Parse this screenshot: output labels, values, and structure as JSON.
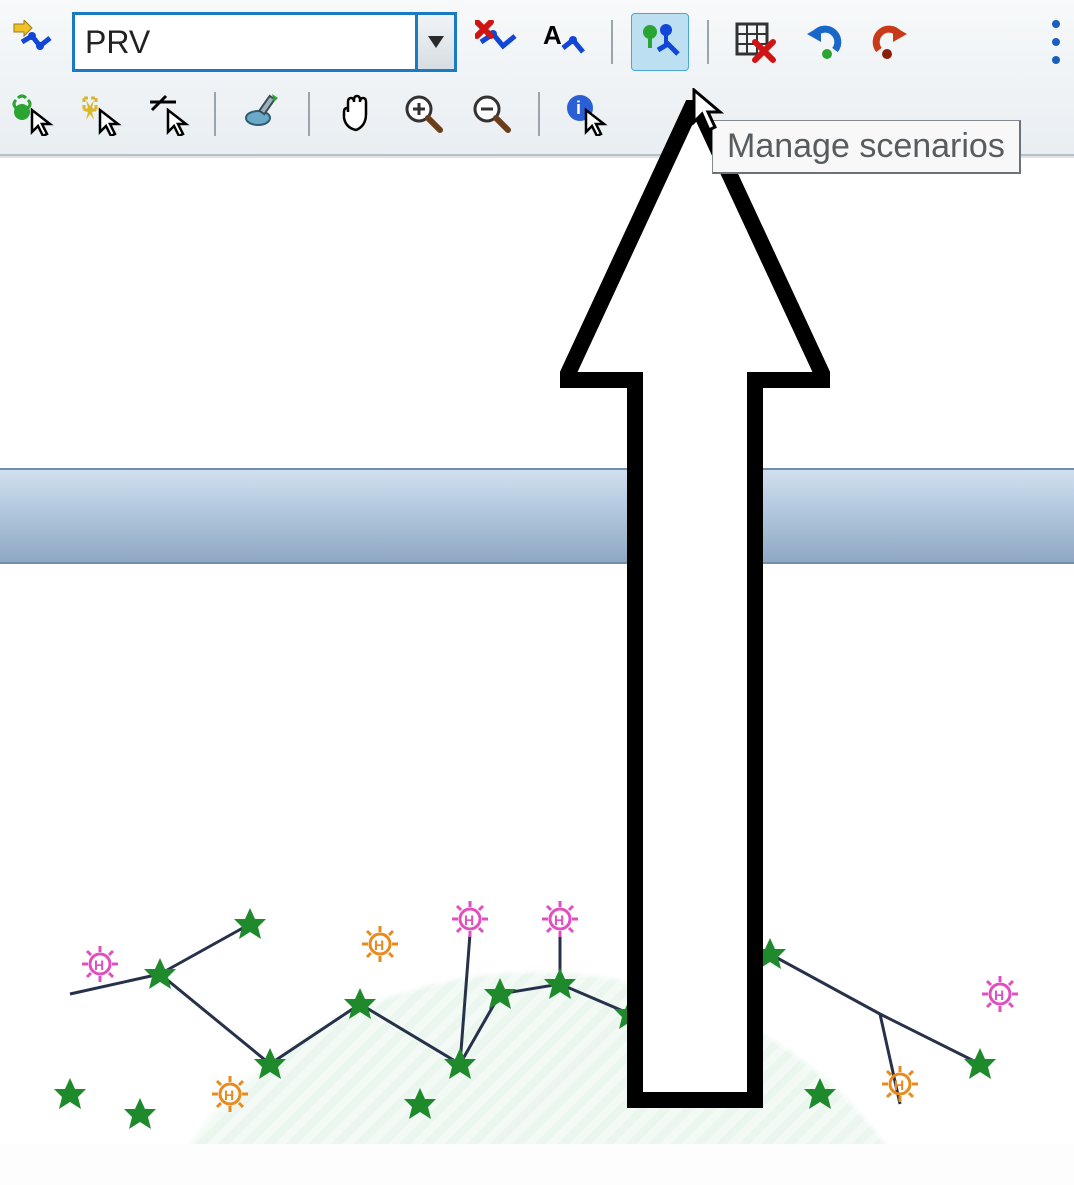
{
  "toolbar": {
    "combo_value": "PRV",
    "tooltip": "Manage scenarios",
    "row1": {
      "new_node": "new-node",
      "delete_node": "delete-node",
      "label_node": "label-node",
      "manage_scenarios": "manage-scenarios",
      "delete_table": "delete-table",
      "undo": "undo",
      "redo": "redo"
    },
    "row2": {
      "select_object": "select-object",
      "select_area": "select-area",
      "select_path": "select-path",
      "edit": "edit",
      "pan": "pan",
      "zoom_in": "zoom-in",
      "zoom_out": "zoom-out",
      "info": "info"
    }
  }
}
